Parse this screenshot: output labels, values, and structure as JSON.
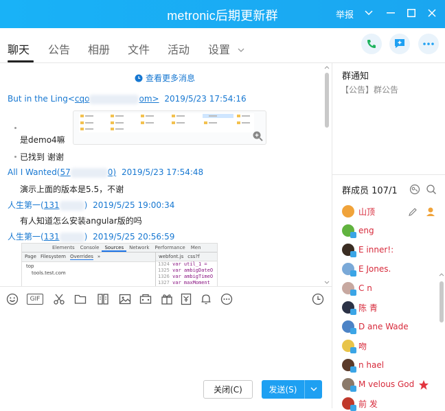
{
  "window": {
    "title": "metronic后期更新群",
    "report_label": "举报",
    "accent": "#19b2f7"
  },
  "tabs": [
    {
      "label": "聊天",
      "active": true
    },
    {
      "label": "公告"
    },
    {
      "label": "相册"
    },
    {
      "label": "文件"
    },
    {
      "label": "活动"
    },
    {
      "label": "设置"
    }
  ],
  "chat": {
    "view_more": "查看更多消息",
    "messages": [
      {
        "sender_prefix": "But in the Ling<",
        "sender_id_start": "cqo",
        "sender_id_end": "om>",
        "time": "2019/5/23 17:54:16"
      },
      {
        "text": "是demo4嘛"
      },
      {
        "text": "已找到 谢谢"
      },
      {
        "sender_prefix": "All I Wanted(",
        "sender_id_start": "57",
        "sender_id_end": "0)",
        "time": "2019/5/23 17:54:48"
      },
      {
        "text": "演示上面的版本是5.5，不谢"
      },
      {
        "sender_prefix": "人生第一(",
        "sender_id_start": "131",
        "sender_id_end": ")",
        "time": "2019/5/25 19:00:34"
      },
      {
        "text": "有人知道怎么安装angular版的吗"
      },
      {
        "sender_prefix": "人生第一(",
        "sender_id_start": "131",
        "sender_id_end": ")",
        "time": "2019/5/25 20:56:59"
      }
    ],
    "devtools": {
      "tabs": [
        "Elements",
        "Console",
        "Sources",
        "Network",
        "Performance",
        "Men"
      ],
      "subtabs": [
        "Page",
        "Filesystem",
        "Overrides",
        "»"
      ],
      "files": [
        "webfont.js",
        "css?f"
      ],
      "tree": [
        "top",
        "tools.test.com"
      ],
      "lines": [
        {
          "no": "1324",
          "code": "var util_1 ="
        },
        {
          "no": "1325",
          "code": "var ambigDateO"
        },
        {
          "no": "1326",
          "code": "var ambigTimeO"
        },
        {
          "no": "1327",
          "code": "var maxMoment"
        }
      ]
    }
  },
  "toolbar": {
    "icons": [
      "emoji-icon",
      "gif-icon",
      "scissors-icon",
      "folder-icon",
      "doc-icon",
      "image-icon",
      "screen-icon",
      "gift-icon",
      "money-icon",
      "bell-icon",
      "more-icon",
      "history-icon"
    ],
    "gif_label": "GIF"
  },
  "input": {
    "close_label": "关闭(C)",
    "send_label": "发送(S)"
  },
  "right_panel": {
    "notice_title": "群通知",
    "notice_body": "【公告】群公告",
    "members_title": "群成员 107/1",
    "members": [
      {
        "name": "山顶",
        "avatar_color": "#f0a33a"
      },
      {
        "name": "eng",
        "avatar_color": "#61b33f",
        "badge": "#3ba5e6"
      },
      {
        "name": "E inner!:",
        "avatar_color": "#3a2d23",
        "badge": "#3ba5e6"
      },
      {
        "name": "E Jones.",
        "avatar_color": "#7aa9d8",
        "badge": "#3ba5e6"
      },
      {
        "name": "C n",
        "avatar_color": "#c7a8a0",
        "badge": "#3ba5e6"
      },
      {
        "name": "陈 青",
        "avatar_color": "#2b3246",
        "badge": "#3ba5e6"
      },
      {
        "name": "D ane  Wade",
        "avatar_color": "#4c83c6",
        "badge": "#3ba5e6"
      },
      {
        "name": "吻",
        "avatar_color": "#e8c44a",
        "badge": "#3ba5e6"
      },
      {
        "name": "n hael",
        "avatar_color": "#5a3a2a",
        "badge": "#3ba5e6"
      },
      {
        "name": "M velous God",
        "avatar_color": "#8b7a6a",
        "badge": "#3ba5e6"
      },
      {
        "name": "前 发",
        "avatar_color": "#c0392b",
        "badge": "#3ba5e6"
      }
    ]
  }
}
